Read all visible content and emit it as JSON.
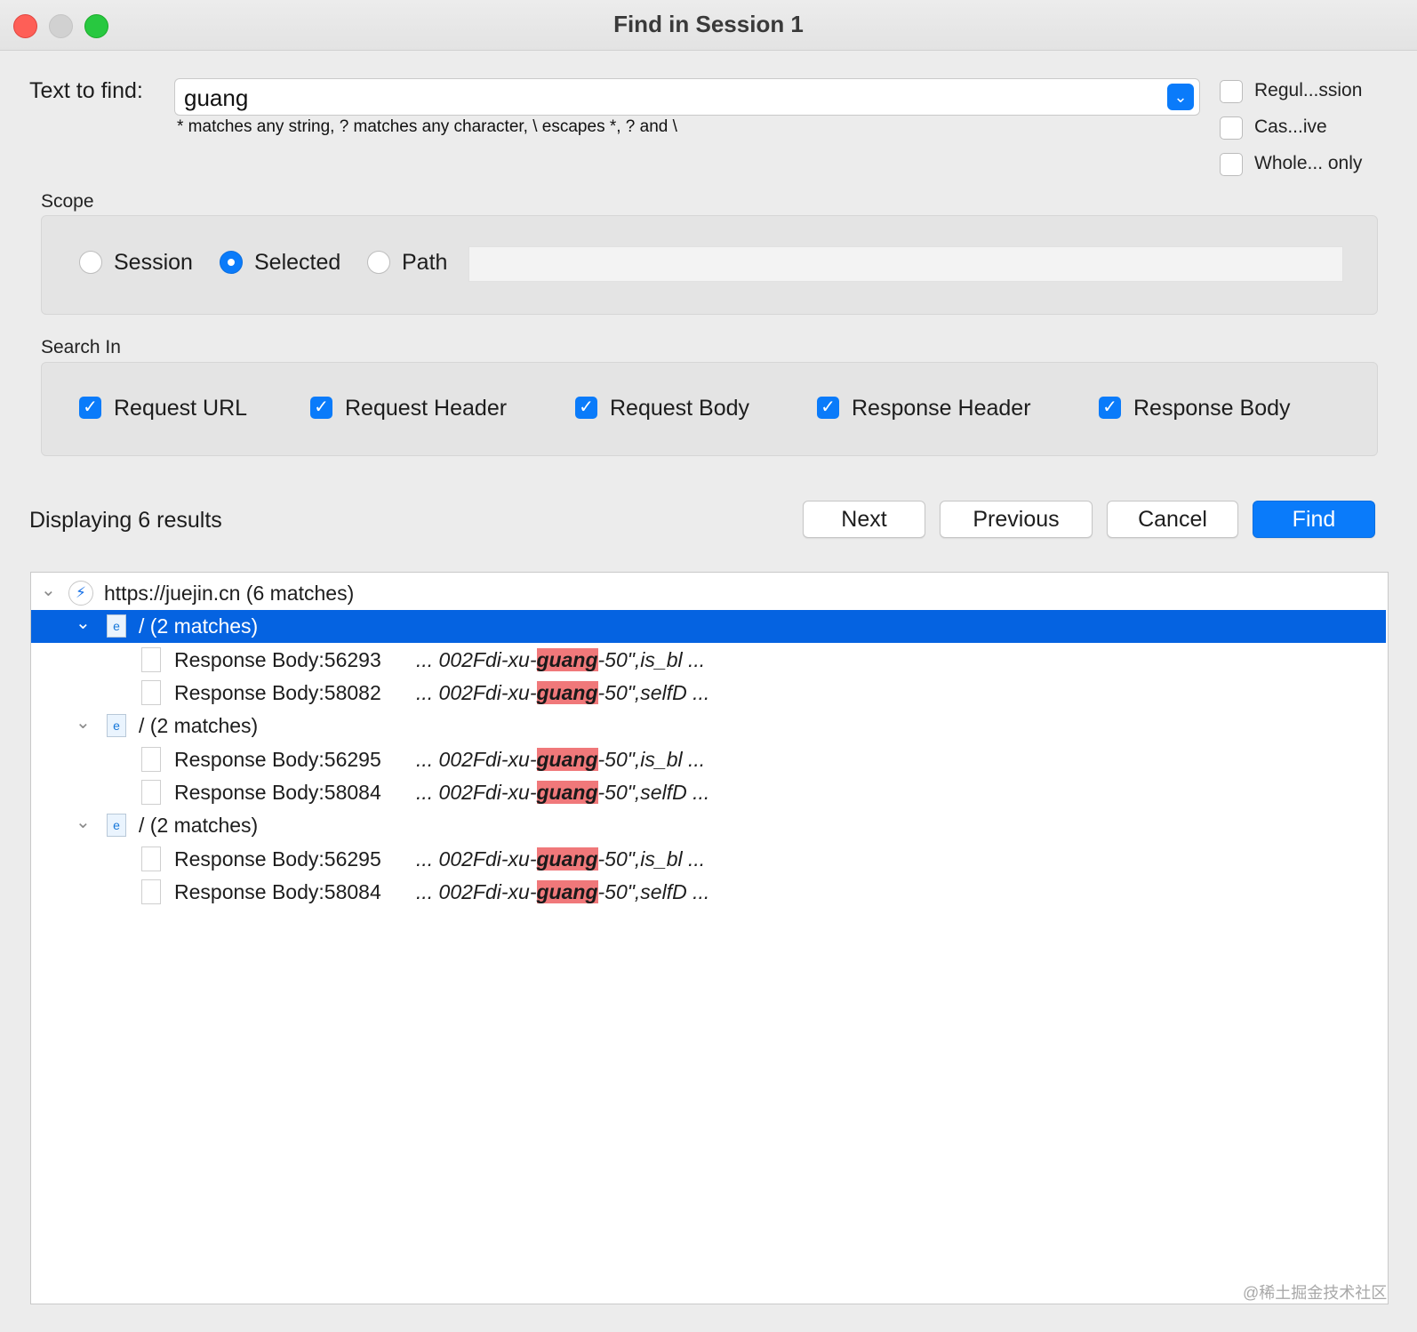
{
  "window": {
    "title": "Find in Session 1"
  },
  "find": {
    "label": "Text to find:",
    "value": "guang",
    "hint": "* matches any string, ? matches any character, \\ escapes *, ? and \\"
  },
  "options": [
    {
      "label": "Regul...ssion",
      "checked": false
    },
    {
      "label": "Cas...ive",
      "checked": false
    },
    {
      "label": "Whole... only",
      "checked": false
    }
  ],
  "scope": {
    "title": "Scope",
    "radios": [
      {
        "label": "Session",
        "selected": false
      },
      {
        "label": "Selected",
        "selected": true
      },
      {
        "label": "Path",
        "selected": false
      }
    ],
    "path_value": ""
  },
  "search_in": {
    "title": "Search In",
    "checks": [
      {
        "label": "Request URL",
        "checked": true
      },
      {
        "label": "Request Header",
        "checked": true
      },
      {
        "label": "Request Body",
        "checked": true
      },
      {
        "label": "Response Header",
        "checked": true
      },
      {
        "label": "Response Body",
        "checked": true
      }
    ]
  },
  "results_label": "Displaying 6 results",
  "buttons": {
    "next": "Next",
    "previous": "Previous",
    "cancel": "Cancel",
    "find": "Find"
  },
  "tree": {
    "root": "https://juejin.cn (6 matches)",
    "groups": [
      {
        "label": "/ (2 matches)",
        "selected": true,
        "items": [
          {
            "label": "Response Body:56293",
            "pre": "... 002Fdi-xu-",
            "match": "guang",
            "post": "-50\",is_bl ..."
          },
          {
            "label": "Response Body:58082",
            "pre": "... 002Fdi-xu-",
            "match": "guang",
            "post": "-50\",selfD ..."
          }
        ]
      },
      {
        "label": "/ (2 matches)",
        "selected": false,
        "items": [
          {
            "label": "Response Body:56295",
            "pre": "... 002Fdi-xu-",
            "match": "guang",
            "post": "-50\",is_bl ..."
          },
          {
            "label": "Response Body:58084",
            "pre": "... 002Fdi-xu-",
            "match": "guang",
            "post": "-50\",selfD ..."
          }
        ]
      },
      {
        "label": "/ (2 matches)",
        "selected": false,
        "items": [
          {
            "label": "Response Body:56295",
            "pre": "... 002Fdi-xu-",
            "match": "guang",
            "post": "-50\",is_bl ..."
          },
          {
            "label": "Response Body:58084",
            "pre": "... 002Fdi-xu-",
            "match": "guang",
            "post": "-50\",selfD ..."
          }
        ]
      }
    ]
  },
  "watermark": "@稀土掘金技术社区",
  "colors": {
    "accent": "#0a7bfa",
    "selection": "#0563e1",
    "match_highlight": "#f0787a"
  }
}
